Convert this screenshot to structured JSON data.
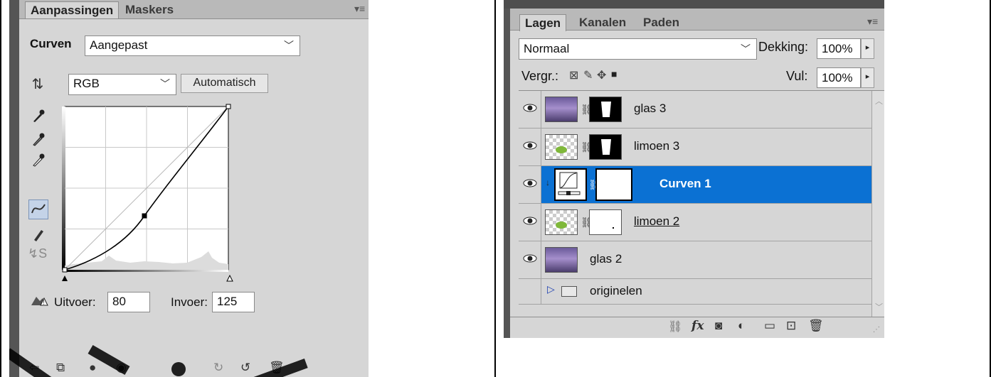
{
  "adjustments_panel": {
    "tabs": [
      {
        "label": "Aanpassingen",
        "active": true
      },
      {
        "label": "Maskers",
        "active": false
      }
    ],
    "menu_icon": "panel-menu-icon",
    "preset_label": "Curven",
    "preset_value": "Aangepast",
    "channel_value": "RGB",
    "auto_button": "Automatisch",
    "output_label": "Uitvoer:",
    "output_value": "80",
    "input_label": "Invoer:",
    "input_value": "125",
    "tools": [
      "on-image-adjust-icon",
      "black-point-eyedropper-icon",
      "gray-point-eyedropper-icon",
      "white-point-eyedropper-icon",
      "curve-edit-points-icon",
      "pencil-draw-icon",
      "smooth-icon",
      "clipping-warning-icon"
    ],
    "bottom_icons": [
      "back-arrow-icon",
      "expanded-view-icon",
      "clip-to-layer-icon",
      "visibility-eye-icon",
      "previous-state-icon",
      "reset-icon",
      "trash-icon"
    ]
  },
  "layers_panel": {
    "tabs": [
      {
        "label": "Lagen",
        "active": true
      },
      {
        "label": "Kanalen",
        "active": false
      },
      {
        "label": "Paden",
        "active": false
      }
    ],
    "blend_mode": "Normaal",
    "opacity_label": "Dekking:",
    "opacity_value": "100%",
    "lock_label": "Vergr.:",
    "fill_label": "Vul:",
    "fill_value": "100%",
    "layers": [
      {
        "name": "glas 3",
        "selected": false,
        "visible": true
      },
      {
        "name": "limoen 3",
        "selected": false,
        "visible": true
      },
      {
        "name": "Curven 1",
        "selected": true,
        "visible": true
      },
      {
        "name": "limoen 2",
        "selected": false,
        "visible": true
      },
      {
        "name": "glas 2",
        "selected": false,
        "visible": true
      },
      {
        "name": "originelen",
        "selected": false,
        "visible": false
      }
    ],
    "bottom_icons": [
      "link-layers-icon",
      "fx-icon",
      "add-mask-icon",
      "adjustment-layer-icon",
      "group-folder-icon",
      "new-layer-icon",
      "trash-icon"
    ]
  },
  "colors": {
    "panel_bg": "#d6d6d6",
    "selected_row": "#0b71d3"
  }
}
